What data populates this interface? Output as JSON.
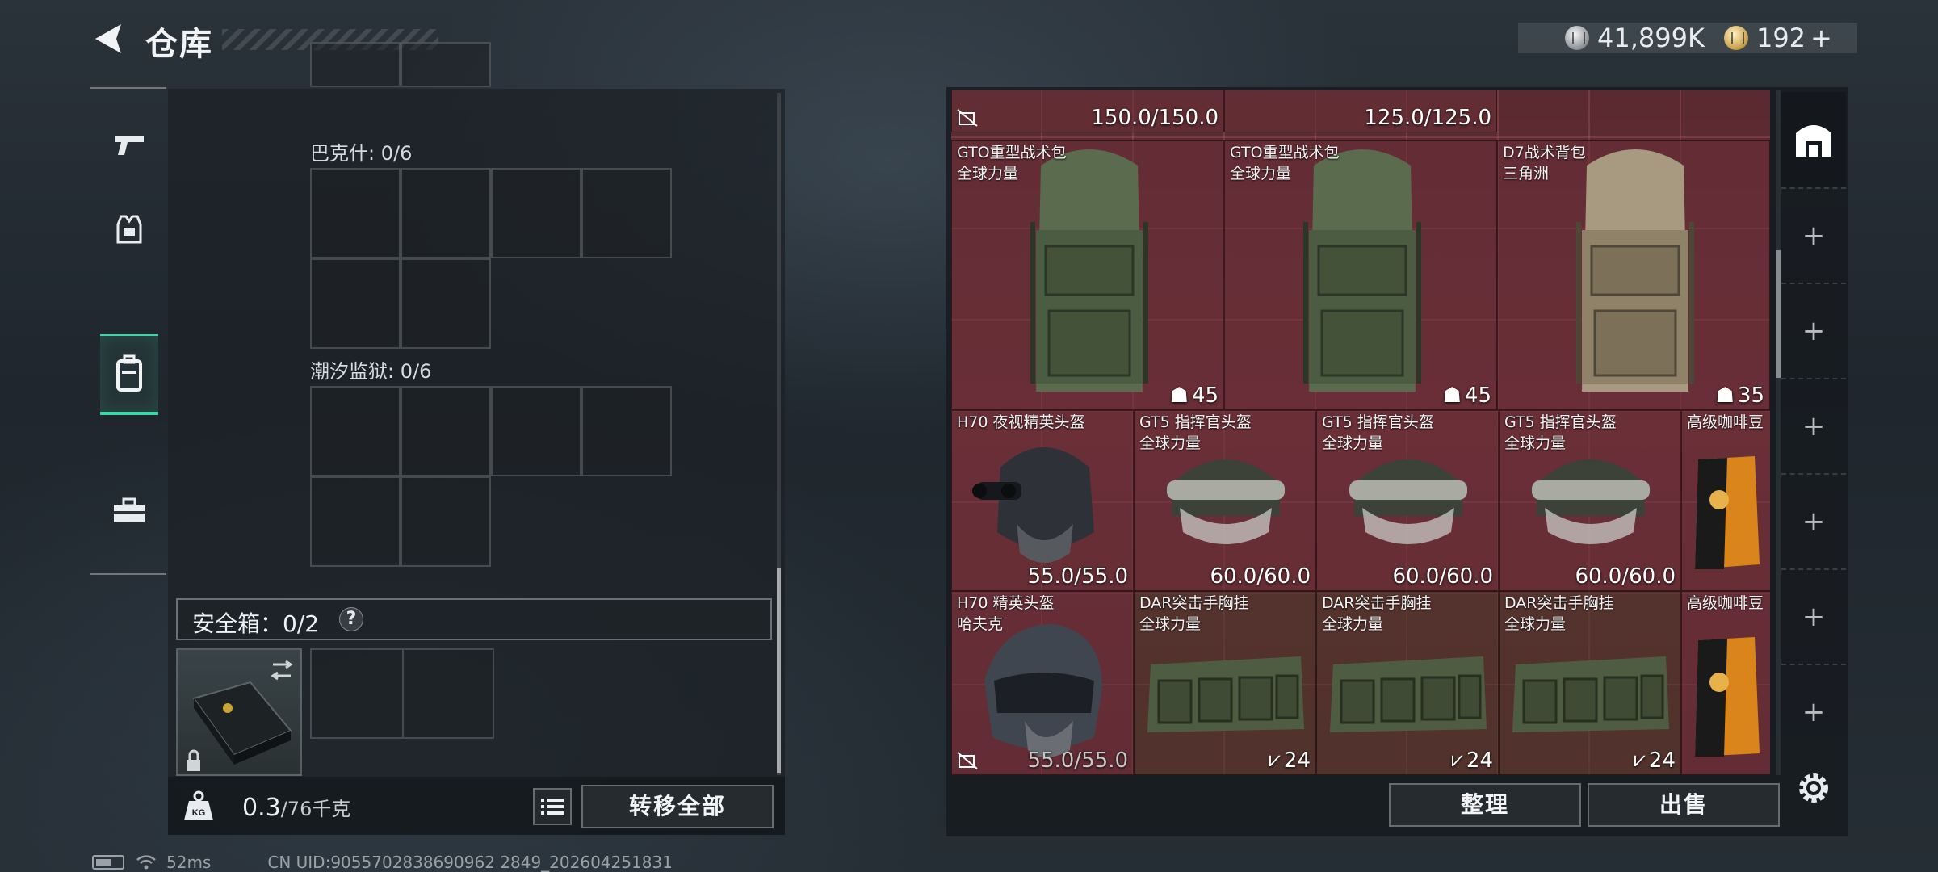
{
  "header": {
    "title": "仓库"
  },
  "currency": {
    "silver": "41,899K",
    "gold": "192",
    "gold_add": "+"
  },
  "nav": [
    {
      "name": "weapon",
      "icon": "pistol-icon"
    },
    {
      "name": "armor",
      "icon": "vest-icon"
    },
    {
      "name": "backpack",
      "icon": "backpack-icon"
    },
    {
      "name": "toolbox",
      "icon": "toolbox-icon"
    }
  ],
  "left": {
    "sections": [
      {
        "label": "巴克什: 0/6"
      },
      {
        "label": "潮汐监狱: 0/6"
      }
    ],
    "safebox": {
      "label": "安全箱：0/2",
      "help": "?"
    },
    "weight": {
      "value": "0.3",
      "capacity": "/76千克"
    },
    "transfer_all": "转移全部"
  },
  "status": {
    "ping": "52ms",
    "uid": "CN UID:9055702838690962 2849_202604251831"
  },
  "stash": {
    "top_values": [
      "150.0/150.0",
      "125.0/125.0"
    ],
    "items": [
      {
        "name": "GTO重型战术包",
        "sub": "全球力量",
        "count": "45"
      },
      {
        "name": "GTO重型战术包",
        "sub": "全球力量",
        "count": "45"
      },
      {
        "name": "D7战术背包",
        "sub": "三角洲",
        "count": "35"
      },
      {
        "name": "H70 夜视精英头盔",
        "sub": "",
        "value": "55.0/55.0"
      },
      {
        "name": "GT5 指挥官头盔",
        "sub": "全球力量",
        "value": "60.0/60.0"
      },
      {
        "name": "GT5 指挥官头盔",
        "sub": "全球力量",
        "value": "60.0/60.0"
      },
      {
        "name": "GT5 指挥官头盔",
        "sub": "全球力量",
        "value": "60.0/60.0"
      },
      {
        "name": "高级咖啡豆",
        "sub": ""
      },
      {
        "name": "H70 精英头盔",
        "sub": "哈夫克",
        "value": "55.0/55.0"
      },
      {
        "name": "DAR突击手胸挂",
        "sub": "全球力量",
        "count": "24"
      },
      {
        "name": "DAR突击手胸挂",
        "sub": "全球力量",
        "count": "24"
      },
      {
        "name": "DAR突击手胸挂",
        "sub": "全球力量",
        "count": "24"
      },
      {
        "name": "高级咖啡豆",
        "sub": ""
      }
    ]
  },
  "actions": {
    "sort": "整理",
    "sell": "出售"
  },
  "storage_tabs": [
    "+",
    "+",
    "+",
    "+",
    "+",
    "+"
  ]
}
